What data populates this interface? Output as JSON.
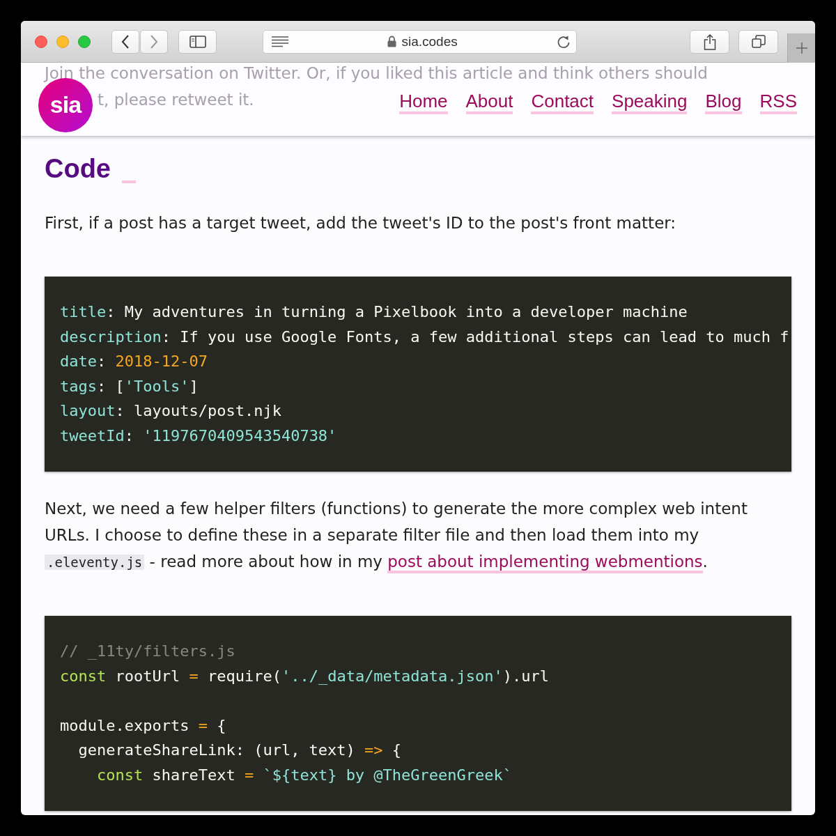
{
  "browser": {
    "address": "sia.codes"
  },
  "backdrop_text": [
    "Join the conversation on Twitter. Or, if you liked this article and think others should",
    "t, please retweet it."
  ],
  "site_header": {
    "logo": "sia",
    "nav": [
      "Home",
      "About",
      "Contact",
      "Speaking",
      "Blog",
      "RSS"
    ]
  },
  "article": [
    {
      "kind": "heading",
      "text": "Code"
    },
    {
      "kind": "paragraph",
      "parts": [
        {
          "kind": "text",
          "text": "First, if a post has a target tweet, add the tweet's ID to the post's front matter:"
        }
      ]
    },
    {
      "kind": "code",
      "groups": [
        [
          [
            {
              "kind": "key",
              "text": "title"
            },
            {
              "kind": "plain",
              "text": ": My adventures in turning a Pixelbook into a developer machine"
            }
          ],
          [
            {
              "kind": "key",
              "text": "description"
            },
            {
              "kind": "plain",
              "text": ": If you use Google Fonts, a few additional steps can lead to much f"
            }
          ],
          [
            {
              "kind": "key",
              "text": "date"
            },
            {
              "kind": "plain",
              "text": ":"
            },
            {
              "kind": "number",
              "text": " 2018-12-07"
            }
          ],
          [
            {
              "kind": "key",
              "text": "tags"
            },
            {
              "kind": "plain",
              "text": ": ["
            },
            {
              "kind": "string",
              "text": "'Tools'"
            },
            {
              "kind": "plain",
              "text": "]"
            }
          ],
          [
            {
              "kind": "key",
              "text": "layout"
            },
            {
              "kind": "plain",
              "text": ": layouts/post.njk"
            }
          ],
          [
            {
              "kind": "key",
              "text": "tweetId"
            },
            {
              "kind": "plain",
              "text": ":"
            },
            {
              "kind": "string",
              "text": " '1197670409543540738'"
            }
          ]
        ]
      ]
    },
    {
      "kind": "paragraph",
      "parts": [
        {
          "kind": "text",
          "text": "Next, we need a few helper filters (functions) to generate the more complex web intent URLs. I choose to define these in a separate filter file and then load them into my "
        },
        {
          "kind": "code",
          "text": ".eleventy.js"
        },
        {
          "kind": "text",
          "text": " - read more about how in my "
        },
        {
          "kind": "link",
          "text": "post about implementing webmentions"
        },
        {
          "kind": "text",
          "text": "."
        }
      ]
    },
    {
      "kind": "code",
      "groups": [
        [
          [
            {
              "kind": "comment",
              "text": "// _11ty/filters.js"
            }
          ],
          [
            {
              "kind": "keyword",
              "text": "const"
            },
            {
              "kind": "plain",
              "text": " rootUrl "
            },
            {
              "kind": "operator",
              "text": "="
            },
            {
              "kind": "plain",
              "text": " require("
            },
            {
              "kind": "string",
              "text": "'../_data/metadata.json'"
            },
            {
              "kind": "plain",
              "text": ").url"
            }
          ]
        ],
        [
          [
            {
              "kind": "plain",
              "text": "module.exports "
            },
            {
              "kind": "operator",
              "text": "="
            },
            {
              "kind": "plain",
              "text": " {"
            }
          ],
          [
            {
              "kind": "plain",
              "text": "  generateShareLink: (url, text) "
            },
            {
              "kind": "operator",
              "text": "=>"
            },
            {
              "kind": "plain",
              "text": " {"
            }
          ],
          [
            {
              "kind": "keyword",
              "text": "    const"
            },
            {
              "kind": "plain",
              "text": " shareText "
            },
            {
              "kind": "operator",
              "text": "= "
            },
            {
              "kind": "string",
              "text": "`${text} by @TheGreenGreek`"
            }
          ]
        ]
      ]
    }
  ]
}
